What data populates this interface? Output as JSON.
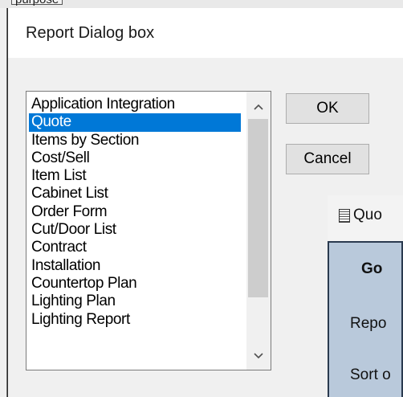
{
  "background": {
    "top_text": "purpose",
    "window_title": "Quo",
    "panel_heading": "Go",
    "panel_line_1": "Repo",
    "panel_line_2": "Sort o"
  },
  "dialog": {
    "title": "Report Dialog box",
    "list": {
      "items": [
        "Application Integration",
        "Quote",
        "Items by Section",
        "Cost/Sell",
        "Item List",
        "Cabinet List",
        "Order Form",
        "Cut/Door List",
        "Contract",
        "Installation",
        "Countertop Plan",
        "Lighting Plan",
        "Lighting Report"
      ],
      "selected_index": 1
    },
    "buttons": {
      "ok": "OK",
      "cancel": "Cancel"
    }
  },
  "colors": {
    "selection": "#0078d7",
    "button_face": "#e1e1e1",
    "panel_bg": "#b9c9db"
  }
}
